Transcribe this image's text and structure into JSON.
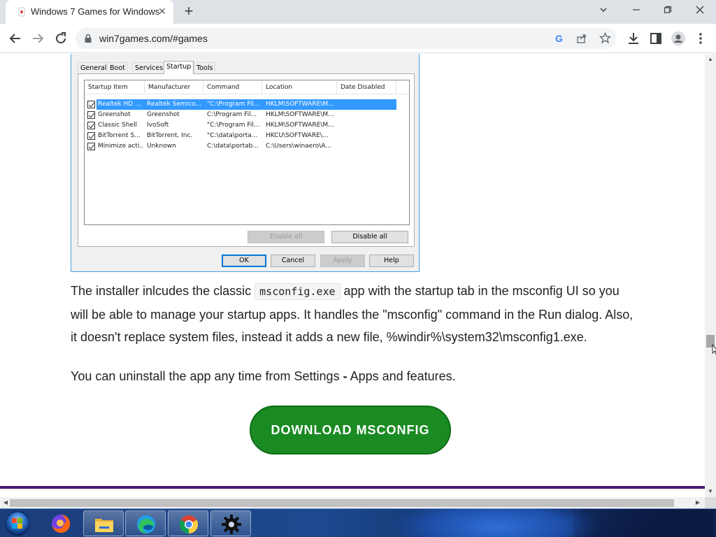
{
  "browser": {
    "tab_title": "Windows 7 Games for Windows",
    "url": "win7games.com/#games"
  },
  "msconfig": {
    "tabs": [
      "General",
      "Boot",
      "Services",
      "Startup",
      "Tools"
    ],
    "active_tab": "Startup",
    "columns": [
      "Startup Item",
      "Manufacturer",
      "Command",
      "Location",
      "Date Disabled"
    ],
    "rows": [
      {
        "item": "Realtek HD ...",
        "manufacturer": "Realtek Semico...",
        "command": "\"C:\\Program Fil...",
        "location": "HKLM\\SOFTWARE\\M...",
        "date_disabled": "",
        "checked": true,
        "selected": true
      },
      {
        "item": "Greenshot",
        "manufacturer": "Greenshot",
        "command": "C:\\Program Fil...",
        "location": "HKLM\\SOFTWARE\\M...",
        "date_disabled": "",
        "checked": true,
        "selected": false
      },
      {
        "item": "Classic Shell",
        "manufacturer": "IvoSoft",
        "command": "\"C:\\Program Fil...",
        "location": "HKLM\\SOFTWARE\\M...",
        "date_disabled": "",
        "checked": true,
        "selected": false
      },
      {
        "item": "BitTorrent S...",
        "manufacturer": "BitTorrent, Inc.",
        "command": "\"C:\\data\\porta...",
        "location": "HKCU\\SOFTWARE\\...",
        "date_disabled": "",
        "checked": true,
        "selected": false
      },
      {
        "item": "Minimize acti...",
        "manufacturer": "Unknown",
        "command": "C:\\data\\portab...",
        "location": "C:\\Users\\winaero\\A...",
        "date_disabled": "",
        "checked": true,
        "selected": false
      }
    ],
    "enable_all": "Enable all",
    "disable_all": "Disable all",
    "ok": "OK",
    "cancel": "Cancel",
    "apply": "Apply",
    "help": "Help"
  },
  "article": {
    "p1_before": "The installer inlcudes the classic",
    "p1_code": "msconfig.exe",
    "p1_after": "app with the startup tab in the msconfig UI so you will be able to manage your startup apps. It handles the \"msconfig\" command in the Run dialog. Also, it doesn't replace system files, instead it adds a new file, %windir%\\system32\\msconfig1.exe.",
    "p2_before": "You can uninstall the app any time from Settings ",
    "p2_bold": "-",
    "p2_after": " Apps and features.",
    "download_label": "DOWNLOAD MSCONFIG"
  },
  "icons": {
    "back": "back-arrow-icon",
    "forward": "forward-arrow-icon",
    "reload": "reload-icon",
    "lock": "lock-icon",
    "google": "google-icon",
    "share": "share-icon",
    "star": "bookmark-star-icon",
    "download": "download-icon",
    "sidepanel": "side-panel-icon",
    "profile": "profile-icon",
    "menu": "kebab-menu-icon"
  },
  "taskbar": {
    "apps": [
      "Firefox",
      "File Explorer",
      "Microsoft Edge",
      "Google Chrome",
      "Settings"
    ]
  },
  "colors": {
    "download_button": "#1a8a22",
    "selection": "#3399ff",
    "divider": "#4b1a6e"
  }
}
